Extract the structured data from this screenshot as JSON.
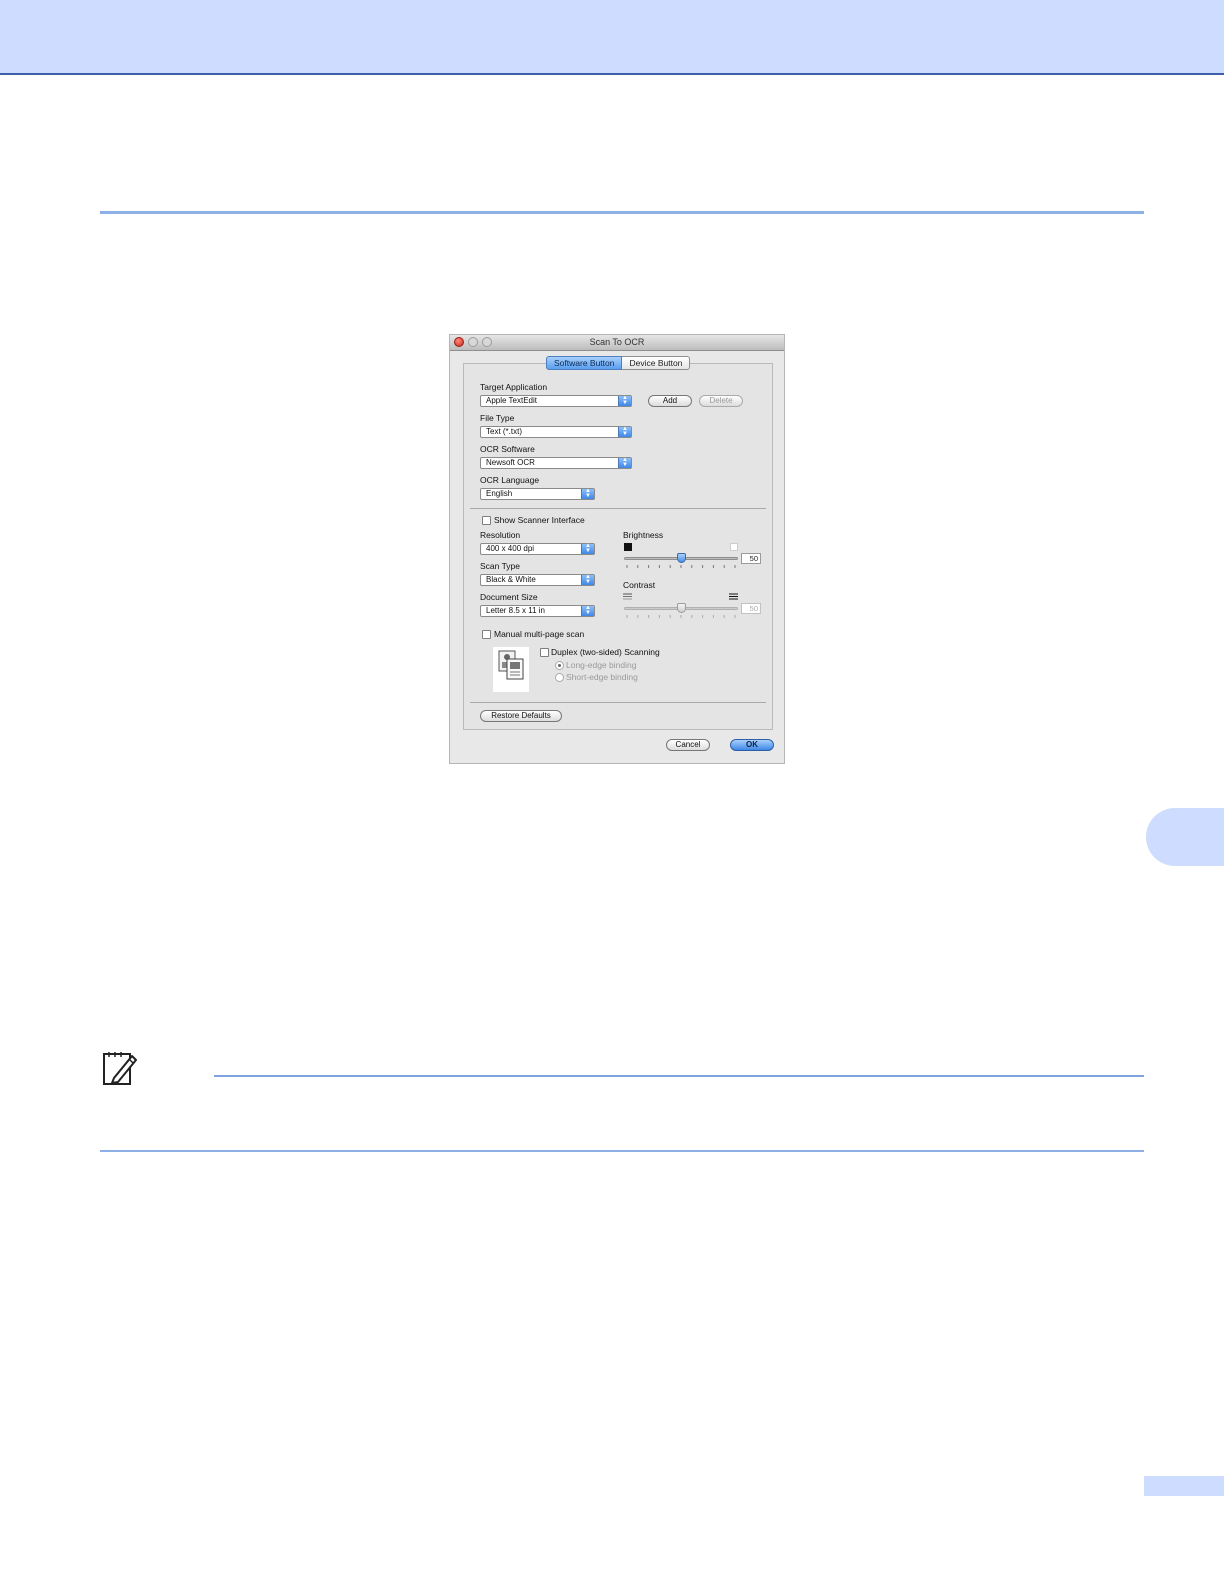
{
  "page": {
    "chapter": "",
    "page_number": ""
  },
  "dialog": {
    "title": "Scan To OCR",
    "tabs": [
      "Software Button",
      "Device Button"
    ],
    "target_application": {
      "label": "Target Application",
      "value": "Apple TextEdit"
    },
    "add_label": "Add",
    "delete_label": "Delete",
    "file_type": {
      "label": "File Type",
      "value": "Text (*.txt)"
    },
    "ocr_software": {
      "label": "OCR Software",
      "value": "Newsoft OCR"
    },
    "ocr_language": {
      "label": "OCR Language",
      "value": "English"
    },
    "show_scanner_interface": {
      "label": "Show Scanner Interface",
      "checked": false
    },
    "resolution": {
      "label": "Resolution",
      "value": "400 x 400 dpi"
    },
    "scan_type": {
      "label": "Scan Type",
      "value": "Black & White"
    },
    "document_size": {
      "label": "Document Size",
      "value": "Letter  8.5 x 11 in"
    },
    "brightness": {
      "label": "Brightness",
      "value": "50",
      "level": 0.5
    },
    "contrast": {
      "label": "Contrast",
      "value": "50",
      "level": 0.5,
      "enabled": false
    },
    "manual_multi_page": {
      "label": "Manual multi-page scan",
      "checked": false
    },
    "duplex": {
      "label": "Duplex (two-sided) Scanning",
      "checked": false
    },
    "long_edge": {
      "label": "Long-edge binding",
      "selected": true
    },
    "short_edge": {
      "label": "Short-edge binding",
      "selected": false
    },
    "restore_defaults_label": "Restore Defaults",
    "cancel_label": "Cancel",
    "ok_label": "OK"
  },
  "colors": {
    "header_band": "#cddcff",
    "rule": "#8fb0e6",
    "accent_blue": "#3f87e6"
  }
}
